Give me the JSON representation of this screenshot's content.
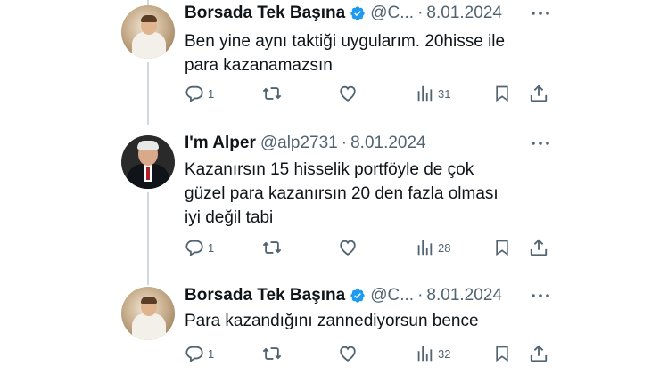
{
  "tweets": [
    {
      "author_name": "Borsada Tek Başına",
      "verified": true,
      "handle": "@C...",
      "separator": "·",
      "date": "8.01.2024",
      "text_lines": [
        "Ben yine aynı taktiği uygularım. 20hisse ile",
        "para kazanamazsın"
      ],
      "replies": "1",
      "views": "31"
    },
    {
      "author_name": "I'm Alper",
      "verified": false,
      "handle": "@alp2731",
      "separator": "·",
      "date": "8.01.2024",
      "text_lines": [
        "Kazanırsın 15 hisselik portföyle de çok",
        "güzel para kazanırsın  20 den fazla olması",
        "iyi değil tabi"
      ],
      "replies": "1",
      "views": "28"
    },
    {
      "author_name": "Borsada Tek Başına",
      "verified": true,
      "handle": "@C...",
      "separator": "·",
      "date": "8.01.2024",
      "text_lines": [
        "Para kazandığını zannediyorsun bence"
      ],
      "replies": "1",
      "views": "32"
    }
  ],
  "colors": {
    "verified_badge": "#1d9bf0",
    "muted_text": "#536471",
    "thread_line": "#cfd9de"
  },
  "icons": [
    "reply-icon",
    "retweet-icon",
    "like-icon",
    "views-icon",
    "bookmark-icon",
    "share-icon",
    "more-icon",
    "verified-badge-icon"
  ]
}
